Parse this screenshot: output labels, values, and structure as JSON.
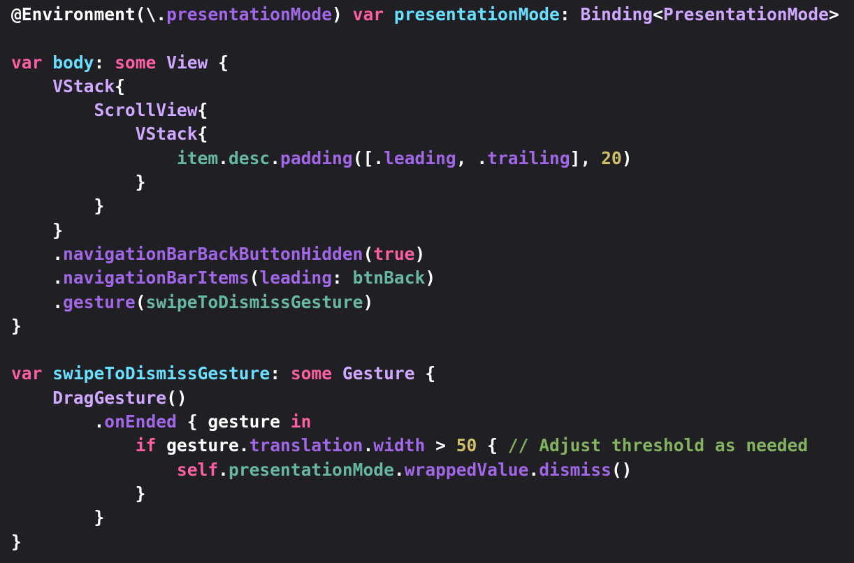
{
  "editor": {
    "colors": {
      "background": "#1f1f24",
      "plain": "#ffffff",
      "keyword": "#fc5fa3",
      "declaration": "#6bdfff",
      "type": "#d0a8ff",
      "method": "#a167e6",
      "variable": "#67b7a4",
      "number": "#d0bf69",
      "comment": "#84b360"
    },
    "lines": [
      [
        {
          "text": "@Environment(\\.",
          "kind": "plain"
        },
        {
          "text": "presentationMode",
          "kind": "method"
        },
        {
          "text": ") ",
          "kind": "plain"
        },
        {
          "text": "var",
          "kind": "keyword"
        },
        {
          "text": " ",
          "kind": "plain"
        },
        {
          "text": "presentationMode",
          "kind": "declaration"
        },
        {
          "text": ": ",
          "kind": "plain"
        },
        {
          "text": "Binding",
          "kind": "type"
        },
        {
          "text": "<",
          "kind": "plain"
        },
        {
          "text": "PresentationMode",
          "kind": "type"
        },
        {
          "text": ">",
          "kind": "plain"
        }
      ],
      [],
      [
        {
          "text": "var",
          "kind": "keyword"
        },
        {
          "text": " ",
          "kind": "plain"
        },
        {
          "text": "body",
          "kind": "declaration"
        },
        {
          "text": ": ",
          "kind": "plain"
        },
        {
          "text": "some",
          "kind": "keyword"
        },
        {
          "text": " ",
          "kind": "plain"
        },
        {
          "text": "View",
          "kind": "type"
        },
        {
          "text": " {",
          "kind": "plain"
        }
      ],
      [
        {
          "text": "    ",
          "kind": "plain"
        },
        {
          "text": "VStack",
          "kind": "type"
        },
        {
          "text": "{",
          "kind": "plain"
        }
      ],
      [
        {
          "text": "        ",
          "kind": "plain"
        },
        {
          "text": "ScrollView",
          "kind": "type"
        },
        {
          "text": "{",
          "kind": "plain"
        }
      ],
      [
        {
          "text": "            ",
          "kind": "plain"
        },
        {
          "text": "VStack",
          "kind": "type"
        },
        {
          "text": "{",
          "kind": "plain"
        }
      ],
      [
        {
          "text": "                ",
          "kind": "plain"
        },
        {
          "text": "item",
          "kind": "variable"
        },
        {
          "text": ".",
          "kind": "plain"
        },
        {
          "text": "desc",
          "kind": "variable"
        },
        {
          "text": ".",
          "kind": "plain"
        },
        {
          "text": "padding",
          "kind": "method"
        },
        {
          "text": "([.",
          "kind": "plain"
        },
        {
          "text": "leading",
          "kind": "method"
        },
        {
          "text": ", .",
          "kind": "plain"
        },
        {
          "text": "trailing",
          "kind": "method"
        },
        {
          "text": "], ",
          "kind": "plain"
        },
        {
          "text": "20",
          "kind": "number"
        },
        {
          "text": ")",
          "kind": "plain"
        }
      ],
      [
        {
          "text": "            }",
          "kind": "plain"
        }
      ],
      [
        {
          "text": "        }",
          "kind": "plain"
        }
      ],
      [
        {
          "text": "    }",
          "kind": "plain"
        }
      ],
      [
        {
          "text": "    .",
          "kind": "plain"
        },
        {
          "text": "navigationBarBackButtonHidden",
          "kind": "method"
        },
        {
          "text": "(",
          "kind": "plain"
        },
        {
          "text": "true",
          "kind": "keyword"
        },
        {
          "text": ")",
          "kind": "plain"
        }
      ],
      [
        {
          "text": "    .",
          "kind": "plain"
        },
        {
          "text": "navigationBarItems",
          "kind": "method"
        },
        {
          "text": "(",
          "kind": "plain"
        },
        {
          "text": "leading",
          "kind": "method"
        },
        {
          "text": ": ",
          "kind": "plain"
        },
        {
          "text": "btnBack",
          "kind": "variable"
        },
        {
          "text": ")",
          "kind": "plain"
        }
      ],
      [
        {
          "text": "    .",
          "kind": "plain"
        },
        {
          "text": "gesture",
          "kind": "method"
        },
        {
          "text": "(",
          "kind": "plain"
        },
        {
          "text": "swipeToDismissGesture",
          "kind": "variable"
        },
        {
          "text": ")",
          "kind": "plain"
        }
      ],
      [
        {
          "text": "}",
          "kind": "plain"
        }
      ],
      [],
      [
        {
          "text": "var",
          "kind": "keyword"
        },
        {
          "text": " ",
          "kind": "plain"
        },
        {
          "text": "swipeToDismissGesture",
          "kind": "declaration"
        },
        {
          "text": ": ",
          "kind": "plain"
        },
        {
          "text": "some",
          "kind": "keyword"
        },
        {
          "text": " ",
          "kind": "plain"
        },
        {
          "text": "Gesture",
          "kind": "type"
        },
        {
          "text": " {",
          "kind": "plain"
        }
      ],
      [
        {
          "text": "    ",
          "kind": "plain"
        },
        {
          "text": "DragGesture",
          "kind": "type"
        },
        {
          "text": "()",
          "kind": "plain"
        }
      ],
      [
        {
          "text": "        .",
          "kind": "plain"
        },
        {
          "text": "onEnded",
          "kind": "method"
        },
        {
          "text": " { gesture ",
          "kind": "plain"
        },
        {
          "text": "in",
          "kind": "keyword"
        }
      ],
      [
        {
          "text": "            ",
          "kind": "plain"
        },
        {
          "text": "if",
          "kind": "keyword"
        },
        {
          "text": " gesture.",
          "kind": "plain"
        },
        {
          "text": "translation",
          "kind": "method"
        },
        {
          "text": ".",
          "kind": "plain"
        },
        {
          "text": "width",
          "kind": "method"
        },
        {
          "text": " > ",
          "kind": "plain"
        },
        {
          "text": "50",
          "kind": "number"
        },
        {
          "text": " { ",
          "kind": "plain"
        },
        {
          "text": "// Adjust threshold as needed",
          "kind": "comment"
        }
      ],
      [
        {
          "text": "                ",
          "kind": "plain"
        },
        {
          "text": "self",
          "kind": "keyword"
        },
        {
          "text": ".",
          "kind": "plain"
        },
        {
          "text": "presentationMode",
          "kind": "variable"
        },
        {
          "text": ".",
          "kind": "plain"
        },
        {
          "text": "wrappedValue",
          "kind": "method"
        },
        {
          "text": ".",
          "kind": "plain"
        },
        {
          "text": "dismiss",
          "kind": "method"
        },
        {
          "text": "()",
          "kind": "plain"
        }
      ],
      [
        {
          "text": "            }",
          "kind": "plain"
        }
      ],
      [
        {
          "text": "        }",
          "kind": "plain"
        }
      ],
      [
        {
          "text": "}",
          "kind": "plain"
        }
      ]
    ]
  }
}
